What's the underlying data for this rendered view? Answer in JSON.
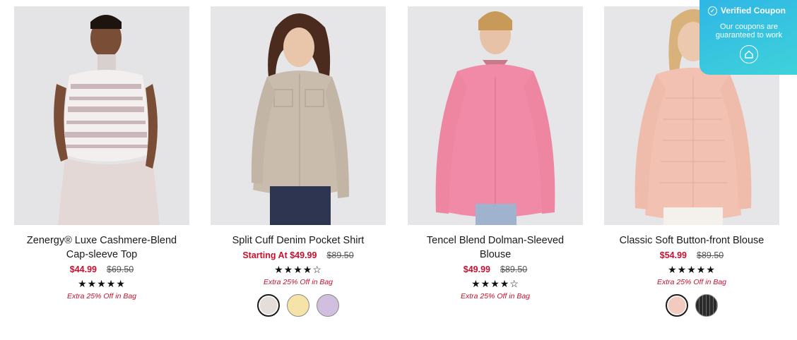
{
  "products": [
    {
      "name": "Zenergy® Luxe Cashmere-Blend Cap-sleeve Top",
      "sale_price": "$44.99",
      "original_price": "$69.50",
      "rating_stars": "★★★★★",
      "rating": 5,
      "promo": "Extra 25% Off in Bag",
      "swatches": []
    },
    {
      "name": "Split Cuff Denim Pocket Shirt",
      "sale_price": "Starting At $49.99",
      "original_price": "$89.50",
      "rating_stars": "★★★★☆",
      "rating": 4,
      "promo": "Extra 25% Off in Bag",
      "swatches": [
        {
          "color": "#e4ddd9",
          "selected": true
        },
        {
          "color": "#f6e3a8",
          "selected": false
        },
        {
          "color": "#d2bede",
          "selected": false
        }
      ]
    },
    {
      "name": "Tencel Blend Dolman-Sleeved Blouse",
      "sale_price": "$49.99",
      "original_price": "$89.50",
      "rating_stars": "★★★★☆",
      "rating": 4,
      "promo": "Extra 25% Off in Bag",
      "swatches": []
    },
    {
      "name": "Classic Soft Button-front Blouse",
      "sale_price": "$54.99",
      "original_price": "$89.50",
      "rating_stars": "★★★★★",
      "rating": 5,
      "promo": "Extra 25% Off in Bag",
      "swatches": [
        {
          "color": "#f2cbc0",
          "selected": true
        },
        {
          "color": "#2a2a2a",
          "selected": false
        }
      ]
    }
  ],
  "coupon": {
    "title": "Verified Coupon",
    "text": "Our coupons are guaranteed to work",
    "icon": "coupon-logo-icon"
  },
  "colors": {
    "sale": "#c8102e",
    "coupon_bg": "#2fb6e6"
  }
}
